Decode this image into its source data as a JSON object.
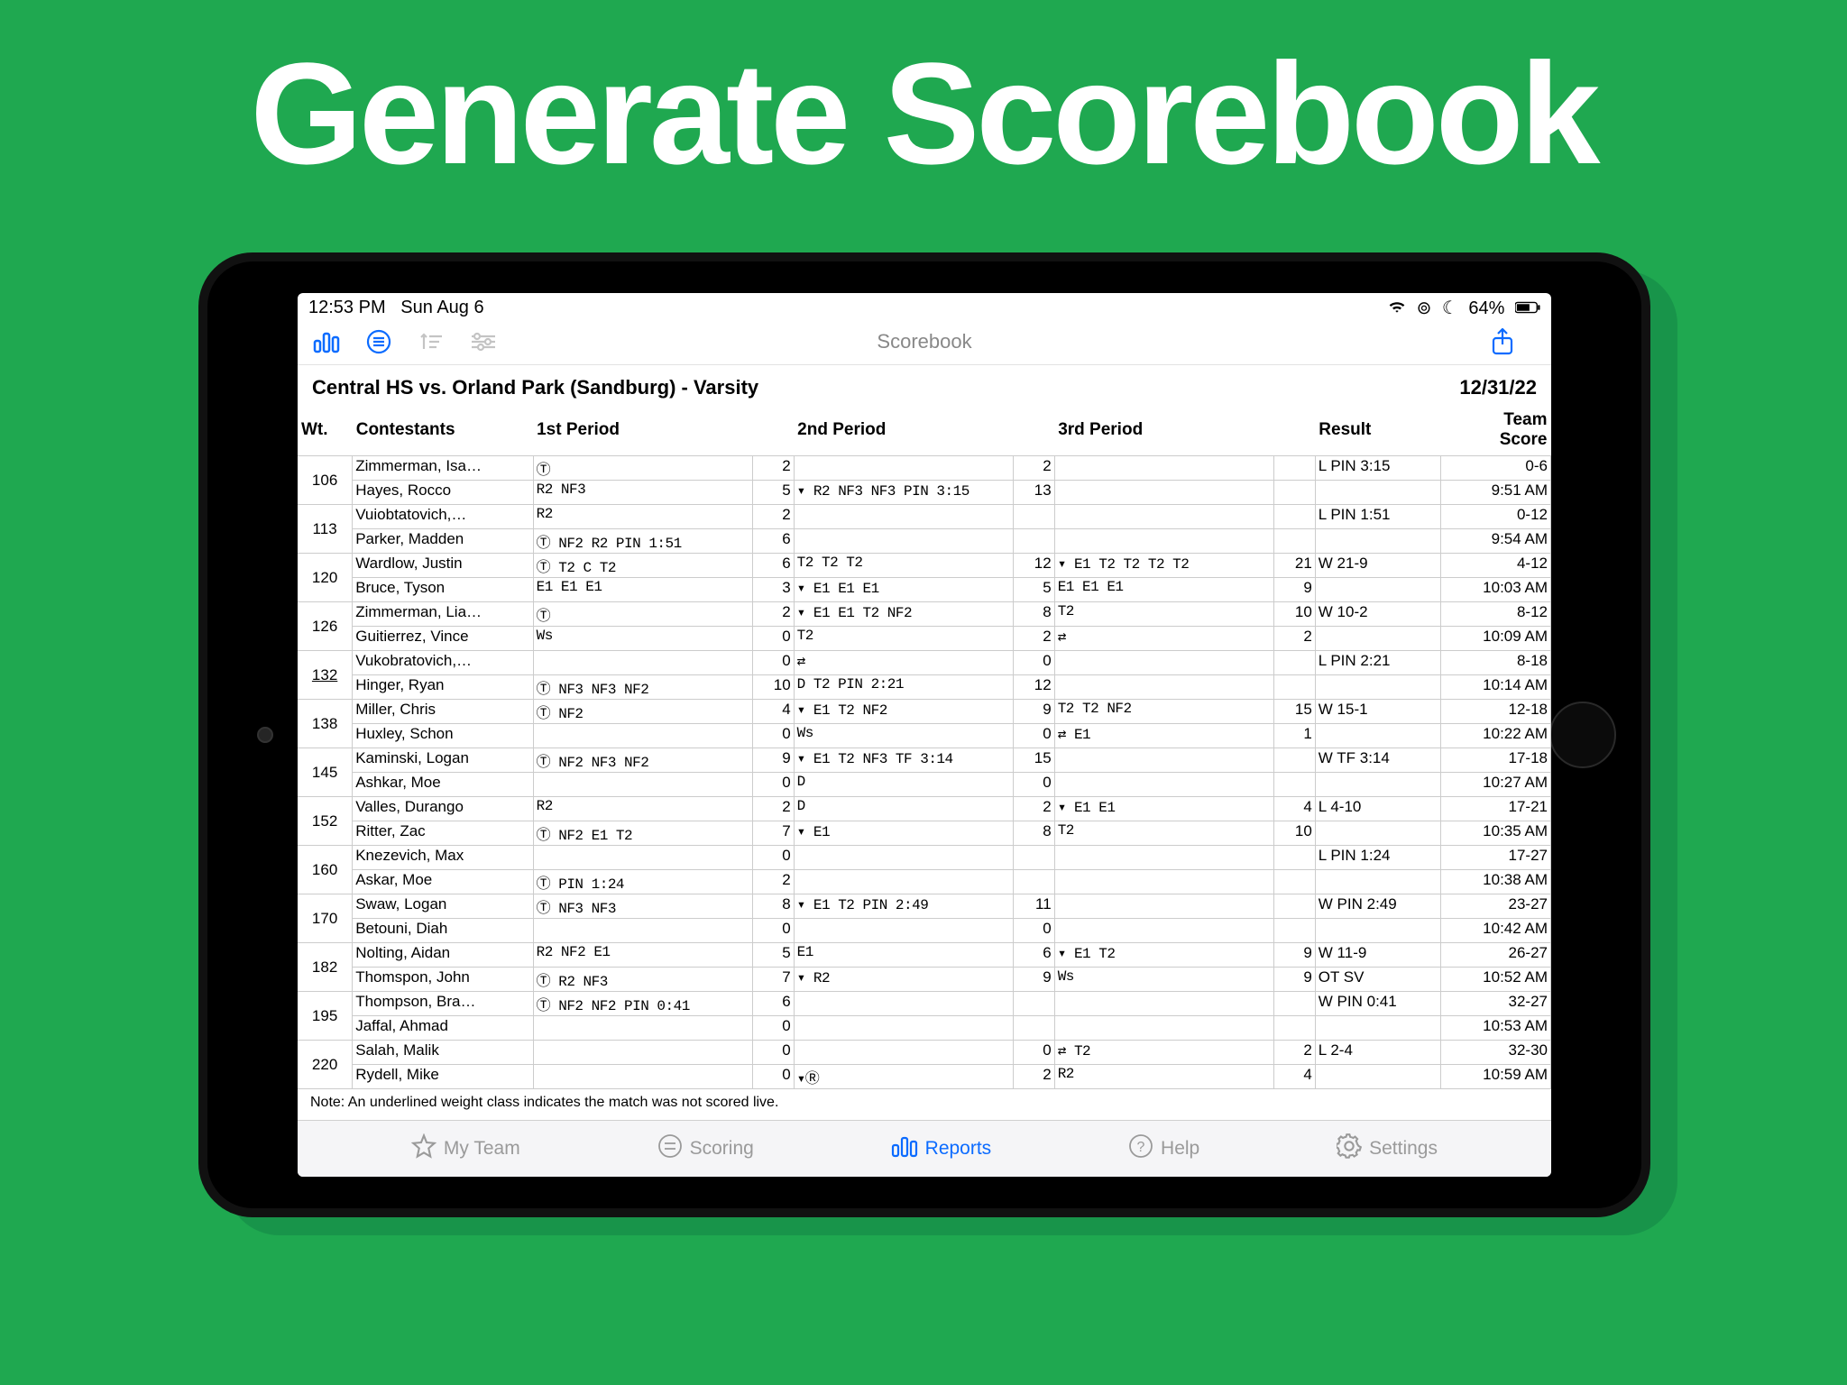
{
  "hero": "Generate Scorebook",
  "status": {
    "time": "12:53 PM",
    "date": "Sun Aug 6",
    "battery": "64%"
  },
  "toolbar": {
    "title": "Scorebook"
  },
  "matchTitle": "Central HS vs. Orland Park (Sandburg) - Varsity",
  "matchDate": "12/31/22",
  "headers": {
    "wt": "Wt.",
    "contestants": "Contestants",
    "p1": "1st Period",
    "p2": "2nd Period",
    "p3": "3rd Period",
    "result": "Result",
    "teamScore1": "Team",
    "teamScore2": "Score"
  },
  "note": "Note: An underlined weight class indicates the match was not scored live.",
  "tabs": {
    "myteam": "My Team",
    "scoring": "Scoring",
    "reports": "Reports",
    "help": "Help",
    "settings": "Settings"
  },
  "rows": [
    {
      "wt": "106",
      "ul": false,
      "a": {
        "name": "Zimmerman, Isa…",
        "p1": "Ⓣ",
        "p1s": "2",
        "p2": "",
        "p2s": "2",
        "p3": "",
        "p3s": "",
        "res": "L PIN 3:15",
        "team": "0-6"
      },
      "b": {
        "name": "Hayes, Rocco",
        "p1": "   R2 NF3",
        "p1s": "5",
        "p2": "▾ R2 NF3 NF3 PIN 3:15",
        "p2s": "13",
        "p3": "",
        "p3s": "",
        "res": "",
        "team": "9:51 AM"
      }
    },
    {
      "wt": "113",
      "ul": false,
      "a": {
        "name": "Vuiobtatovich,…",
        "p1": "     R2",
        "p1s": "2",
        "p2": "",
        "p2s": "",
        "p3": "",
        "p3s": "",
        "res": "L PIN 1:51",
        "team": "0-12"
      },
      "b": {
        "name": "Parker, Madden",
        "p1": "Ⓣ NF2  R2 PIN 1:51",
        "p1s": "6",
        "p2": "",
        "p2s": "",
        "p3": "",
        "p3s": "",
        "res": "",
        "team": "9:54 AM"
      }
    },
    {
      "wt": "120",
      "ul": false,
      "a": {
        "name": "Wardlow, Justin",
        "p1": "Ⓣ  T2  C  T2",
        "p1s": "6",
        "p2": "   T2  T2  T2",
        "p2s": "12",
        "p3": "▾ E1 T2  T2  T2  T2",
        "p3s": "21",
        "res": "W 21-9",
        "team": "4-12"
      },
      "b": {
        "name": "Bruce, Tyson",
        "p1": "   E1  E1   E1",
        "p1s": "3",
        "p2": "▾ E1  E1  E1",
        "p2s": "5",
        "p3": "    E1  E1  E1",
        "p3s": "9",
        "res": "",
        "team": "10:03 AM"
      }
    },
    {
      "wt": "126",
      "ul": false,
      "a": {
        "name": "Zimmerman, Lia…",
        "p1": "Ⓣ",
        "p1s": "2",
        "p2": "▾ E1  E1 T2 NF2",
        "p2s": "8",
        "p3": "   T2",
        "p3s": "10",
        "res": "W 10-2",
        "team": "8-12"
      },
      "b": {
        "name": "Guitierrez, Vince",
        "p1": "   Ws",
        "p1s": "0",
        "p2": "    T2",
        "p2s": "2",
        "p3": "⇄",
        "p3s": "2",
        "res": "",
        "team": "10:09 AM"
      }
    },
    {
      "wt": "132",
      "ul": true,
      "a": {
        "name": "Vukobratovich,…",
        "p1": "",
        "p1s": "0",
        "p2": "⇄",
        "p2s": "0",
        "p3": "",
        "p3s": "",
        "res": "L PIN 2:21",
        "team": "8-18"
      },
      "b": {
        "name": "Hinger, Ryan",
        "p1": "Ⓣ NF3 NF3 NF2",
        "p1s": "10",
        "p2": "D T2 PIN 2:21",
        "p2s": "12",
        "p3": "",
        "p3s": "",
        "res": "",
        "team": "10:14 AM"
      }
    },
    {
      "wt": "138",
      "ul": false,
      "a": {
        "name": "Miller, Chris",
        "p1": "Ⓣ NF2",
        "p1s": "4",
        "p2": "▾  E1 T2 NF2",
        "p2s": "9",
        "p3": "   T2  T2 NF2",
        "p3s": "15",
        "res": "W 15-1",
        "team": "12-18"
      },
      "b": {
        "name": "Huxley, Schon",
        "p1": "",
        "p1s": "0",
        "p2": "   Ws",
        "p2s": "0",
        "p3": "⇄   E1",
        "p3s": "1",
        "res": "",
        "team": "10:22 AM"
      }
    },
    {
      "wt": "145",
      "ul": false,
      "a": {
        "name": "Kaminski, Logan",
        "p1": "Ⓣ NF2 NF3 NF2",
        "p1s": "9",
        "p2": "▾ E1 T2 NF3 TF 3:14",
        "p2s": "15",
        "p3": "",
        "p3s": "",
        "res": "W TF 3:14",
        "team": "17-18"
      },
      "b": {
        "name": "Ashkar, Moe",
        "p1": "",
        "p1s": "0",
        "p2": "D",
        "p2s": "0",
        "p3": "",
        "p3s": "",
        "res": "",
        "team": "10:27 AM"
      }
    },
    {
      "wt": "152",
      "ul": false,
      "a": {
        "name": "Valles, Durango",
        "p1": "     R2",
        "p1s": "2",
        "p2": "D",
        "p2s": "2",
        "p3": "▾ E1  E1",
        "p3s": "4",
        "res": "L 4-10",
        "team": "17-21"
      },
      "b": {
        "name": "Ritter, Zac",
        "p1": "Ⓣ NF2  E1 T2",
        "p1s": "7",
        "p2": "▾ E1",
        "p2s": "8",
        "p3": "    T2",
        "p3s": "10",
        "res": "",
        "team": "10:35 AM"
      }
    },
    {
      "wt": "160",
      "ul": false,
      "a": {
        "name": "Knezevich, Max",
        "p1": "",
        "p1s": "0",
        "p2": "",
        "p2s": "",
        "p3": "",
        "p3s": "",
        "res": "L PIN 1:24",
        "team": "17-27"
      },
      "b": {
        "name": "Askar, Moe",
        "p1": "Ⓣ PIN 1:24",
        "p1s": "2",
        "p2": "",
        "p2s": "",
        "p3": "",
        "p3s": "",
        "res": "",
        "team": "10:38 AM"
      }
    },
    {
      "wt": "170",
      "ul": false,
      "a": {
        "name": "Swaw, Logan",
        "p1": "Ⓣ NF3 NF3",
        "p1s": "8",
        "p2": "▾ E1 T2 PIN 2:49",
        "p2s": "11",
        "p3": "",
        "p3s": "",
        "res": "W PIN 2:49",
        "team": "23-27"
      },
      "b": {
        "name": "Betouni, Diah",
        "p1": "",
        "p1s": "0",
        "p2": "",
        "p2s": "0",
        "p3": "",
        "p3s": "",
        "res": "",
        "team": "10:42 AM"
      }
    },
    {
      "wt": "182",
      "ul": false,
      "a": {
        "name": "Nolting, Aidan",
        "p1": "   R2 NF2     E1",
        "p1s": "5",
        "p2": "    E1",
        "p2s": "6",
        "p3": "▾ E1  T2",
        "p3s": "9",
        "res": "W 11-9",
        "team": "26-27"
      },
      "b": {
        "name": "Thomspon, John",
        "p1": "Ⓣ     R2 NF3",
        "p1s": "7",
        "p2": "▾ R2",
        "p2s": "9",
        "p3": "    Ws",
        "p3s": "9",
        "res": "OT SV",
        "team": "10:52 AM"
      }
    },
    {
      "wt": "195",
      "ul": false,
      "a": {
        "name": "Thompson, Bra…",
        "p1": "Ⓣ NF2 NF2 PIN 0:41",
        "p1s": "6",
        "p2": "",
        "p2s": "",
        "p3": "",
        "p3s": "",
        "res": "W PIN 0:41",
        "team": "32-27"
      },
      "b": {
        "name": "Jaffal, Ahmad",
        "p1": "",
        "p1s": "0",
        "p2": "",
        "p2s": "",
        "p3": "",
        "p3s": "",
        "res": "",
        "team": "10:53 AM"
      }
    },
    {
      "wt": "220",
      "ul": false,
      "a": {
        "name": "Salah, Malik",
        "p1": "",
        "p1s": "0",
        "p2": "",
        "p2s": "0",
        "p3": "⇄ T2",
        "p3s": "2",
        "res": "L 2-4",
        "team": "32-30"
      },
      "b": {
        "name": "Rydell, Mike",
        "p1": "",
        "p1s": "0",
        "p2": "▾Ⓡ",
        "p2s": "2",
        "p3": "    R2",
        "p3s": "4",
        "res": "",
        "team": "10:59 AM"
      }
    }
  ]
}
